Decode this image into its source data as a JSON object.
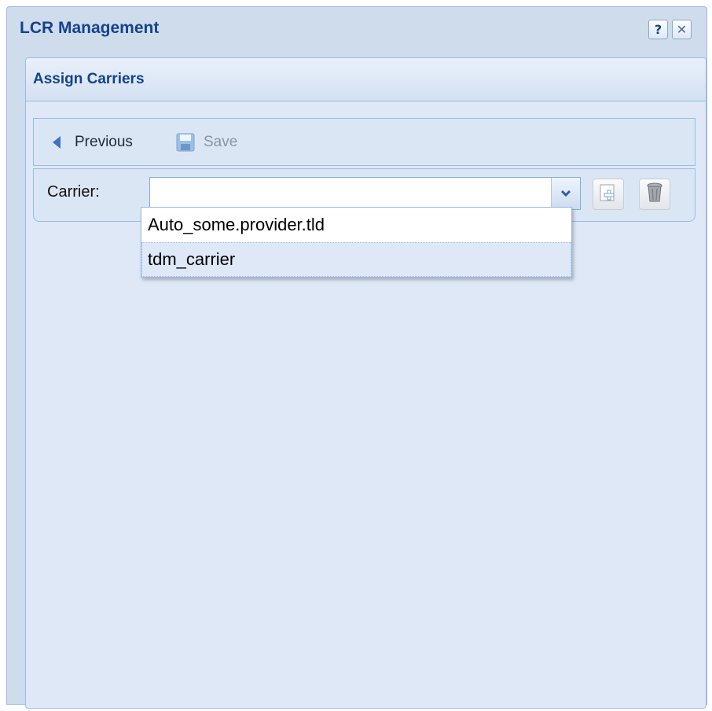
{
  "window": {
    "title": "LCR Management",
    "tools": {
      "help": "?",
      "close": "✕"
    }
  },
  "panel": {
    "title": "Assign Carriers"
  },
  "toolbar": {
    "previous_label": "Previous",
    "save_label": "Save",
    "previous_icon": "arrow-left-icon",
    "save_icon": "floppy-disk-icon"
  },
  "form": {
    "carrier_label": "Carrier:",
    "carrier_value": "",
    "carrier_placeholder": ""
  },
  "dropdown": {
    "options": [
      "Auto_some.provider.tld",
      "tdm_carrier"
    ],
    "highlighted": "tdm_carrier"
  },
  "colors": {
    "title_text": "#15428b",
    "window_bg": "#cfdcec",
    "panel_bg": "#dfe8f6",
    "border": "#99bbe8"
  }
}
